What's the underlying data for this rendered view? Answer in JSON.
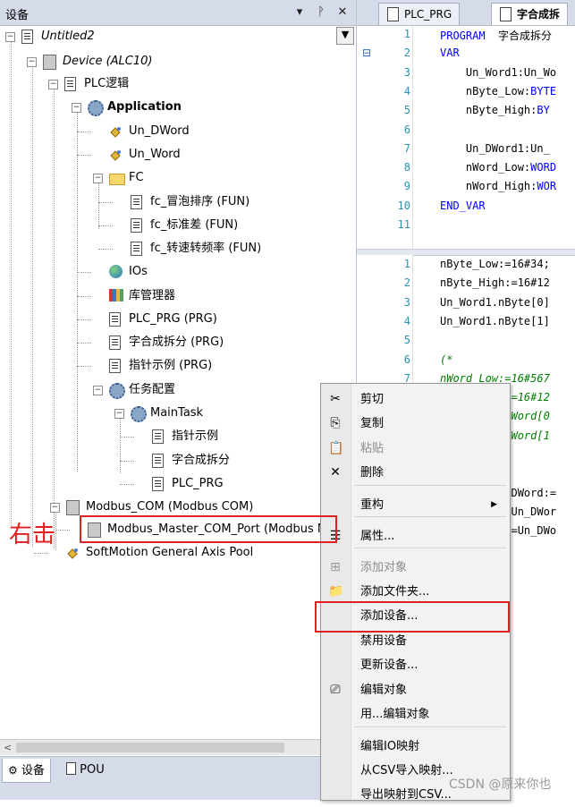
{
  "devices_pane": {
    "title": "设备",
    "pin": "▾",
    "dock": "ᚹ",
    "close": "✕",
    "dropdown": "▼",
    "tree": [
      {
        "label": "Untitled2",
        "style": "italic"
      },
      {
        "label": "Device (ALC10)",
        "style": "italic"
      },
      {
        "label": "PLC逻辑"
      },
      {
        "label": "Application",
        "style": "bold"
      },
      {
        "label": "Un_DWord"
      },
      {
        "label": "Un_Word"
      },
      {
        "label": "FC"
      },
      {
        "label": "fc_冒泡排序 (FUN)"
      },
      {
        "label": "fc_标准差 (FUN)"
      },
      {
        "label": "fc_转速转频率 (FUN)"
      },
      {
        "label": "IOs"
      },
      {
        "label": "库管理器"
      },
      {
        "label": "PLC_PRG (PRG)"
      },
      {
        "label": "字合成拆分 (PRG)"
      },
      {
        "label": "指针示例 (PRG)"
      },
      {
        "label": "任务配置"
      },
      {
        "label": "MainTask"
      },
      {
        "label": "指针示例"
      },
      {
        "label": "字合成拆分"
      },
      {
        "label": "PLC_PRG"
      },
      {
        "label": "Modbus_COM (Modbus COM)"
      },
      {
        "label": "Modbus_Master_COM_Port (Modbus M"
      },
      {
        "label": "SoftMotion General Axis Pool"
      }
    ],
    "bottom_tabs": [
      "设备",
      "POU"
    ],
    "scroll_left": "<"
  },
  "editor": {
    "tabs": [
      "PLC_PRG",
      "字合成拆"
    ],
    "decl_lines": [
      {
        "n": "1",
        "parts": [
          [
            "kw",
            "PROGRAM"
          ],
          [
            "",
            "  字合成拆分"
          ]
        ]
      },
      {
        "n": "2",
        "parts": [
          [
            "kw",
            "VAR"
          ]
        ]
      },
      {
        "n": "3",
        "parts": [
          [
            "",
            "    Un_Word1:Un_Wo"
          ]
        ]
      },
      {
        "n": "4",
        "parts": [
          [
            "",
            "    nByte_Low:"
          ],
          [
            "kw",
            "BYTE"
          ]
        ]
      },
      {
        "n": "5",
        "parts": [
          [
            "",
            "    nByte_High:"
          ],
          [
            "kw",
            "BY"
          ]
        ]
      },
      {
        "n": "6",
        "parts": []
      },
      {
        "n": "7",
        "parts": [
          [
            "",
            "    Un_DWord1:Un_"
          ]
        ]
      },
      {
        "n": "8",
        "parts": [
          [
            "",
            "    nWord_Low:"
          ],
          [
            "kw",
            "WORD"
          ]
        ]
      },
      {
        "n": "9",
        "parts": [
          [
            "",
            "    nWord_High:"
          ],
          [
            "kw",
            "WOR"
          ]
        ]
      },
      {
        "n": "10",
        "parts": [
          [
            "kw",
            "END_VAR"
          ]
        ]
      },
      {
        "n": "11",
        "parts": []
      }
    ],
    "collapse_marker": "⊟",
    "body_lines": [
      {
        "n": "1",
        "parts": [
          [
            "",
            "nByte_Low:=16#34;"
          ]
        ]
      },
      {
        "n": "2",
        "parts": [
          [
            "",
            "nByte_High:=16#12"
          ]
        ]
      },
      {
        "n": "3",
        "parts": [
          [
            "",
            "Un_Word1.nByte[0]"
          ]
        ]
      },
      {
        "n": "4",
        "parts": [
          [
            "",
            "Un_Word1.nByte[1]"
          ]
        ]
      },
      {
        "n": "5",
        "parts": []
      },
      {
        "n": "6",
        "parts": [
          [
            "cm",
            "(*"
          ]
        ]
      },
      {
        "n": "7",
        "parts": [
          [
            "cm",
            "nWord_Low:=16#567"
          ]
        ]
      },
      {
        "n": "8",
        "parts": [
          [
            "cm",
            "nWord_High:=16#12"
          ]
        ]
      },
      {
        "n": "9",
        "parts": [
          [
            "cm",
            "Un_DWord1.nWord[0"
          ]
        ]
      },
      {
        "n": "10",
        "parts": [
          [
            "cm",
            "Un_DWord1.nWord[1"
          ]
        ]
      },
      {
        "n": "11",
        "parts": []
      },
      {
        "n": "12",
        "parts": []
      },
      {
        "n": "13",
        "parts": [
          [
            "",
            "Un_DWord1.nDWord:="
          ]
        ]
      },
      {
        "n": "14",
        "parts": [
          [
            "",
            "nWord_Low:=Un_DWor"
          ]
        ]
      },
      {
        "n": "15",
        "parts": [
          [
            "",
            "nWord_High:=Un_DWo"
          ]
        ]
      }
    ]
  },
  "context_menu": {
    "items": [
      {
        "label": "剪切",
        "icon": "✂",
        "disabled": false
      },
      {
        "label": "复制",
        "icon": "⎘",
        "disabled": false
      },
      {
        "label": "粘贴",
        "icon": "📋",
        "disabled": true
      },
      {
        "label": "删除",
        "icon": "✕",
        "disabled": false
      },
      {
        "label": "重构",
        "icon": "",
        "disabled": false,
        "submenu": true
      },
      {
        "label": "属性...",
        "icon": "☰",
        "disabled": false
      },
      {
        "label": "添加对象",
        "icon": "⊞",
        "disabled": true
      },
      {
        "label": "添加文件夹...",
        "icon": "📁",
        "disabled": false
      },
      {
        "label": "添加设备...",
        "icon": "",
        "disabled": false
      },
      {
        "label": "禁用设备",
        "icon": "",
        "disabled": false
      },
      {
        "label": "更新设备...",
        "icon": "",
        "disabled": false
      },
      {
        "label": "编辑对象",
        "icon": "⎚",
        "disabled": false
      },
      {
        "label": "用...编辑对象",
        "icon": "",
        "disabled": false
      },
      {
        "label": "编辑IO映射",
        "icon": "",
        "disabled": false
      },
      {
        "label": "从CSV导入映射...",
        "icon": "",
        "disabled": false
      },
      {
        "label": "导出映射到CSV...",
        "icon": "",
        "disabled": false
      }
    ],
    "submenu_arrow": "▶"
  },
  "annotation": {
    "note": "右击",
    "color": "#e02020"
  },
  "watermark": "CSDN @原来你也"
}
